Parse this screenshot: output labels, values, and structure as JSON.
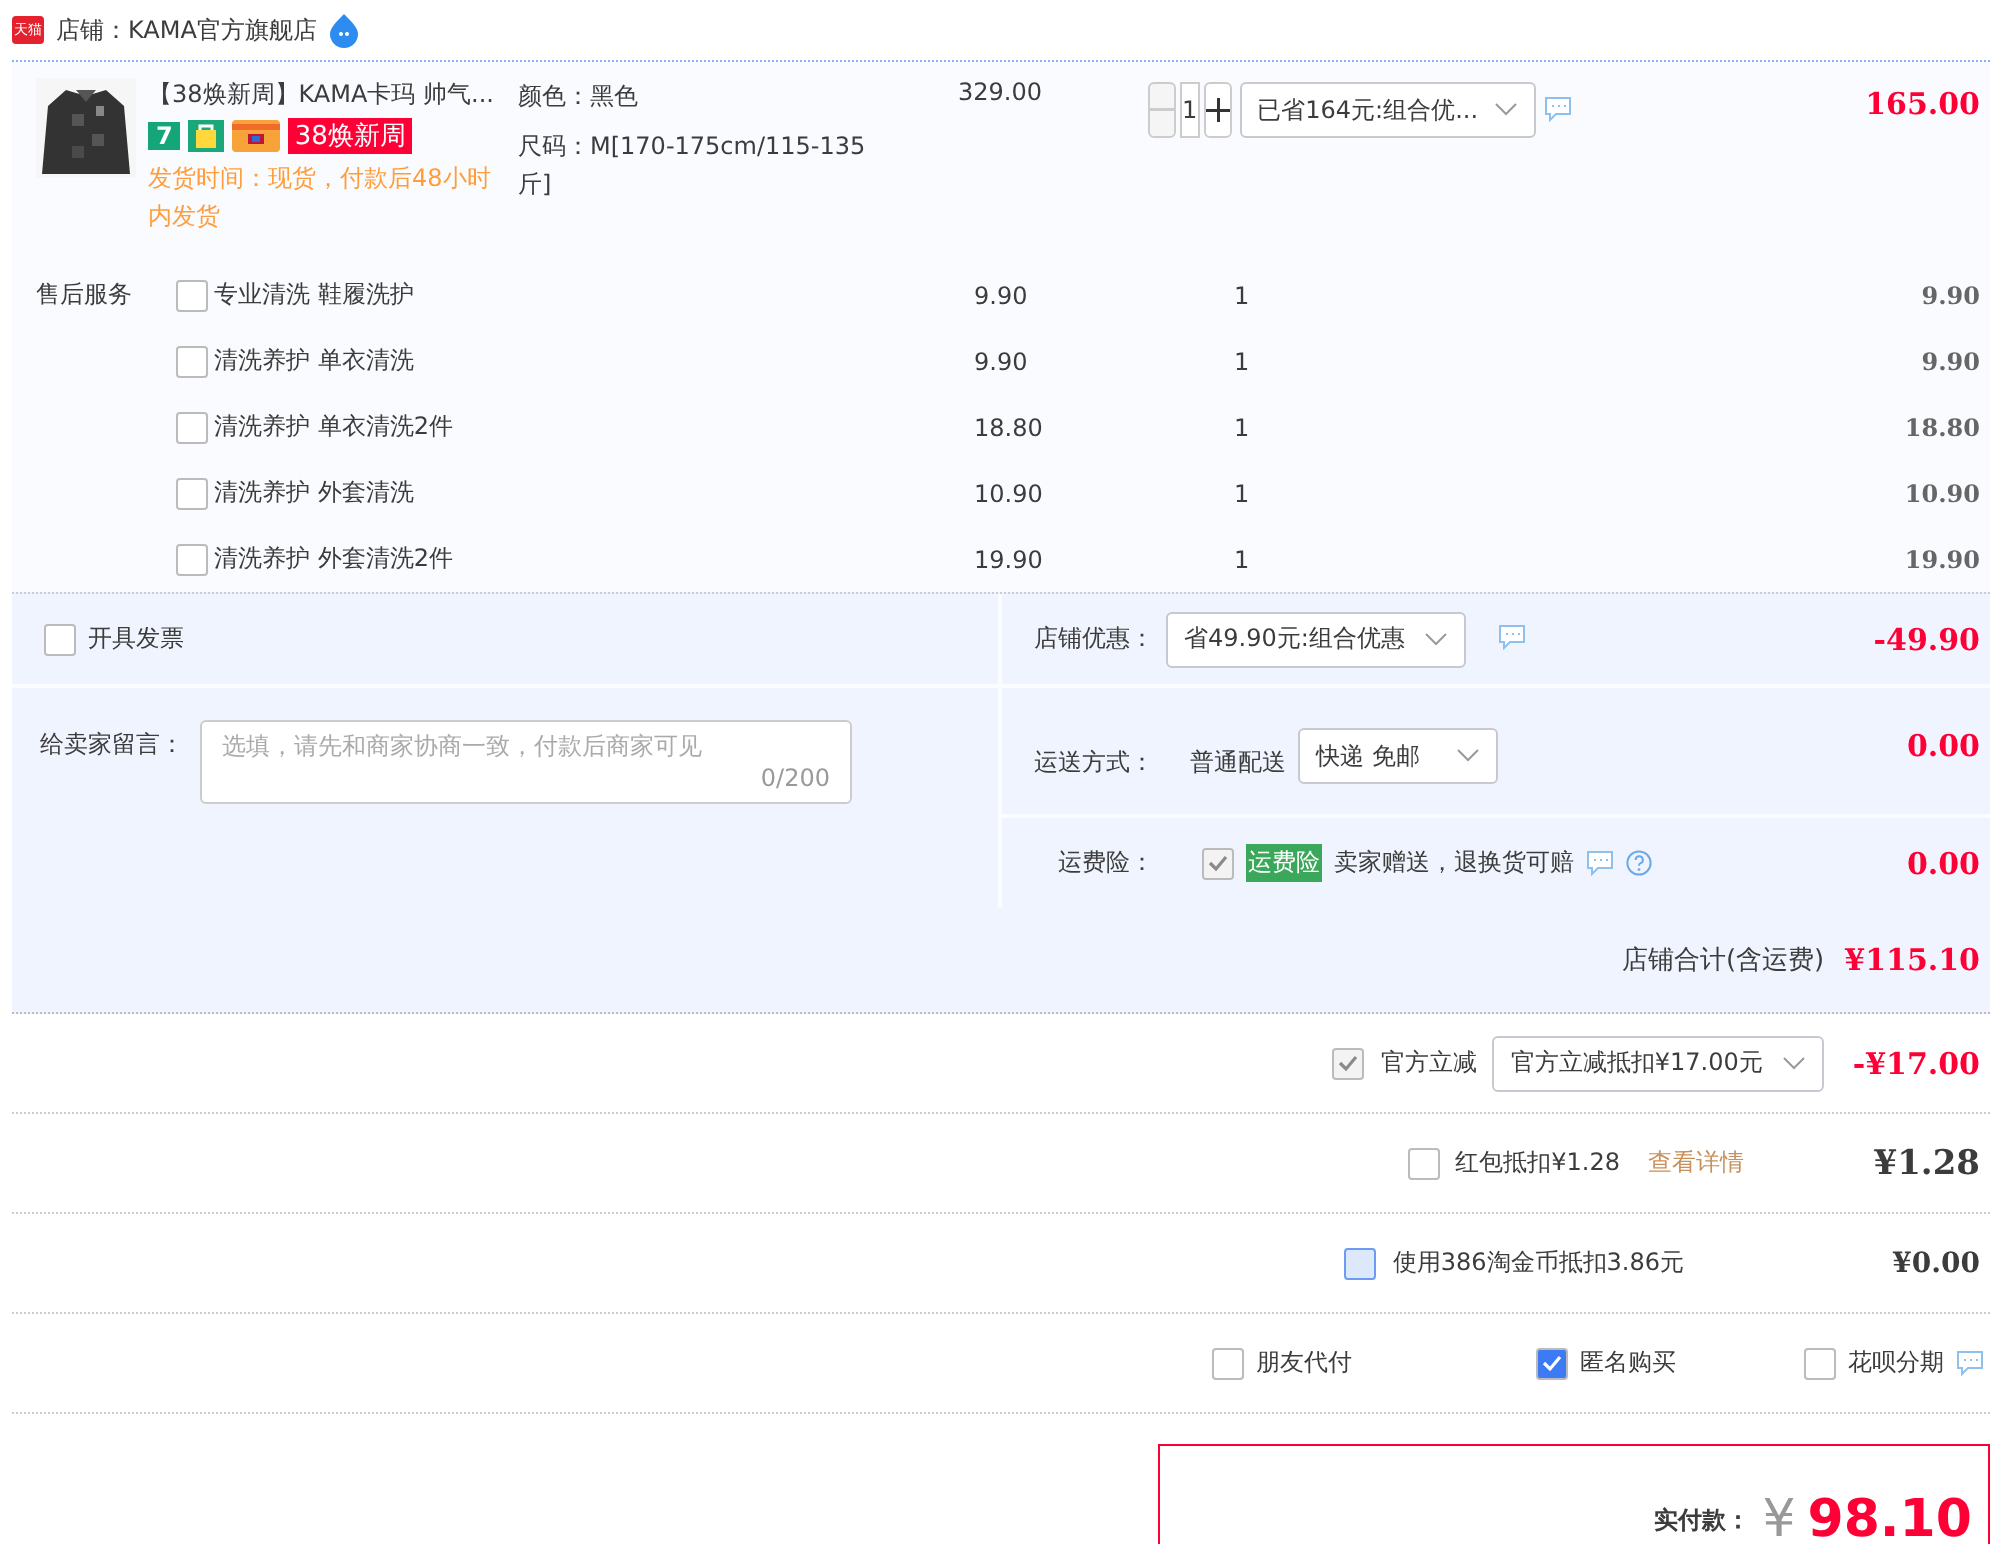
{
  "store": {
    "logo": "天猫",
    "name": "店铺：KAMA官方旗舰店"
  },
  "product": {
    "image": {
      "kind": "picture"
    },
    "title": "【38焕新周】KAMA卡玛 帅气...",
    "badges": [
      {
        "kind": "seven",
        "label": "7"
      },
      {
        "kind": "bag"
      },
      {
        "kind": "card"
      },
      {
        "kind": "promo",
        "label": "38焕新周"
      }
    ],
    "delivery": "发货时间：现货，付款后48小时内发货",
    "props": [
      "颜色：黑色",
      "尺码：M[170-175cm/115-135斤]"
    ],
    "price": "329.00",
    "quantity": "1",
    "minus_disabled": true,
    "discount": "已省164元:组合优...",
    "total": "165.00"
  },
  "services": {
    "label": "售后服务",
    "items": [
      {
        "name": "专业清洗 鞋履洗护",
        "price": "9.90",
        "qty": "1",
        "total": "9.90",
        "checked": false
      },
      {
        "name": "清洗养护 单衣清洗",
        "price": "9.90",
        "qty": "1",
        "total": "9.90",
        "checked": false
      },
      {
        "name": "清洗养护 单衣清洗2件",
        "price": "18.80",
        "qty": "1",
        "total": "18.80",
        "checked": false
      },
      {
        "name": "清洗养护 外套清洗",
        "price": "10.90",
        "qty": "1",
        "total": "10.90",
        "checked": false
      },
      {
        "name": "清洗养护 外套清洗2件",
        "price": "19.90",
        "qty": "1",
        "total": "19.90",
        "checked": false
      }
    ]
  },
  "invoice": {
    "label": "开具发票",
    "checked": false
  },
  "message": {
    "label": "给卖家留言：",
    "placeholder": "选填，请先和商家协商一致，付款后商家可见",
    "counter": "0/200"
  },
  "shop_discount": {
    "label": "店铺优惠：",
    "value": "省49.90元:组合优惠",
    "amount": "-49.90"
  },
  "shipping": {
    "label": "运送方式：",
    "method": "普通配送",
    "value": "快递 免邮",
    "amount": "0.00"
  },
  "insurance": {
    "label": "运费险：",
    "checked": true,
    "disabled": true,
    "tag": "运费险",
    "text": "卖家赠送，退换货可赔",
    "amount": "0.00"
  },
  "store_total": {
    "label": "店铺合计(含运费)",
    "amount": "¥115.10"
  },
  "official": {
    "checked": true,
    "disabled": true,
    "label": "官方立减",
    "value": "官方立减抵扣¥17.00元",
    "amount": "-¥17.00"
  },
  "red_packet": {
    "checked": false,
    "label": "红包抵扣¥1.28",
    "link": "查看详情",
    "amount": "¥1.28"
  },
  "coins": {
    "checked": false,
    "focused": true,
    "label": "使用386淘金币抵扣3.86元",
    "amount": "¥0.00"
  },
  "options": [
    {
      "label": "朋友代付",
      "checked": false,
      "info": false
    },
    {
      "label": "匿名购买",
      "checked": true,
      "info": false
    },
    {
      "label": "花呗分期",
      "checked": false,
      "info": true
    }
  ],
  "payment": {
    "label": "实付款：",
    "currency": "¥",
    "amount": "98.10"
  }
}
